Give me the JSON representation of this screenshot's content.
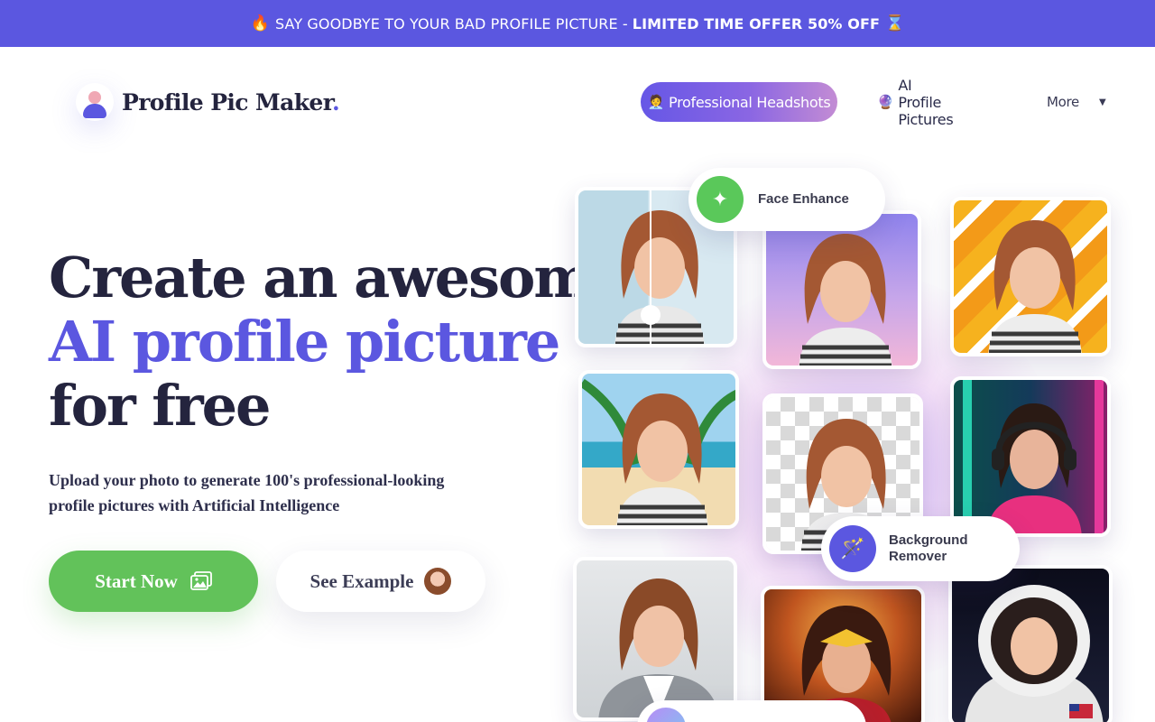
{
  "promo": {
    "fire_icon": "fire-emoji",
    "text": "SAY GOODBYE TO YOUR BAD PROFILE PICTURE -",
    "highlight": "LIMITED TIME OFFER 50% OFF",
    "hourglass_icon": "hourglass-emoji",
    "fire": "🔥",
    "hourglass": "⌛"
  },
  "header": {
    "logo_text": "Profile Pic Maker",
    "logo_dot": ".",
    "nav": {
      "headshots_icon": "🧑‍💼",
      "headshots_label": "Professional Headshots",
      "ai_icon": "🔮",
      "ai_label": "AI Profile Pictures",
      "more_label": "More",
      "more_caret": "▼"
    }
  },
  "hero": {
    "title_line1": "Create an awesome",
    "title_line2": "AI profile picture",
    "title_line3": "for free",
    "subtitle_line1": "Upload your photo to generate 100's professional-looking",
    "subtitle_line2": "profile pictures with Artificial Intelligence",
    "start_label": "Start Now",
    "example_label": "See Example"
  },
  "collage": {
    "face_enhance_label": "Face Enhance",
    "bg_remover_line1": "Background",
    "bg_remover_line2": "Remover",
    "face_enhance_icon": "✦",
    "bg_remover_icon": "🪄"
  },
  "colors": {
    "brand": "#5b57e0",
    "green": "#62c25a",
    "dark": "#24243e"
  }
}
